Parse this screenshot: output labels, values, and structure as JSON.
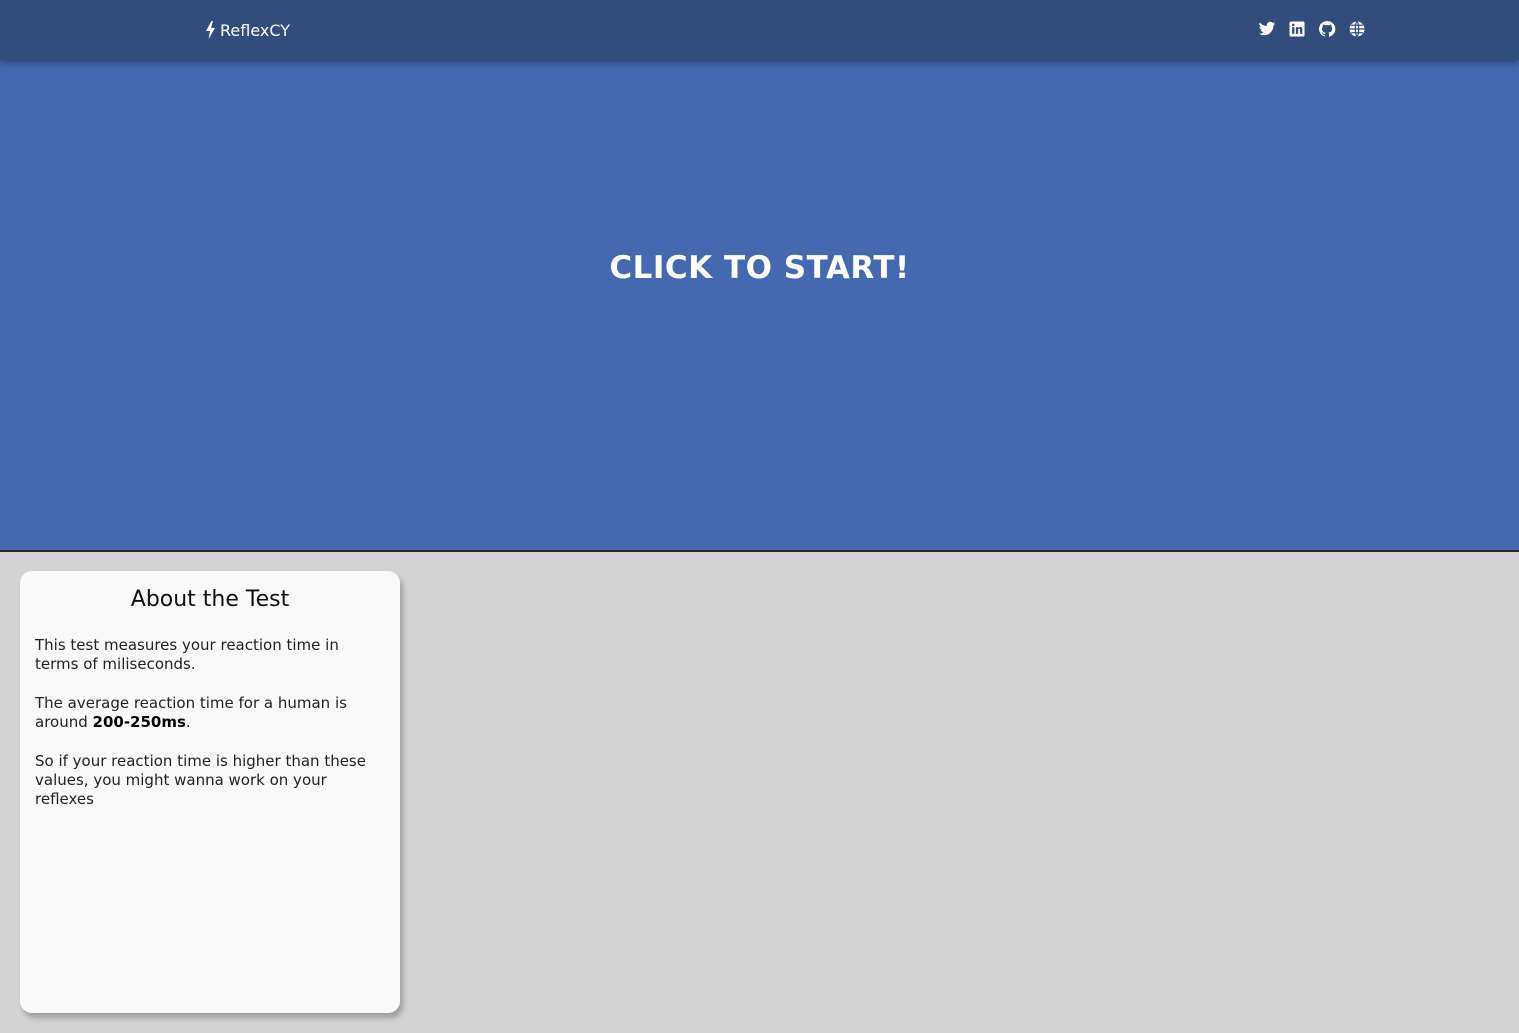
{
  "navbar": {
    "brand": "ReflexCY",
    "social": [
      {
        "icon": "twitter-icon"
      },
      {
        "icon": "linkedin-icon"
      },
      {
        "icon": "github-icon"
      },
      {
        "icon": "globe-icon"
      }
    ]
  },
  "start": {
    "label": "CLICK TO START!"
  },
  "about": {
    "title": "About the Test",
    "p1": "This test measures your reaction time in terms of miliseconds.",
    "p2_prefix": "The average reaction time for a human is around ",
    "p2_bold": "200-250ms",
    "p2_suffix": ".",
    "p3": "So if your reaction time is higher than these values, you might wanna work on your reflexes"
  },
  "colors": {
    "navbar_bg": "#304d7c",
    "start_bg": "#4469b0",
    "page_bg": "#d3d3d3",
    "card_bg": "#f9f9f9"
  }
}
